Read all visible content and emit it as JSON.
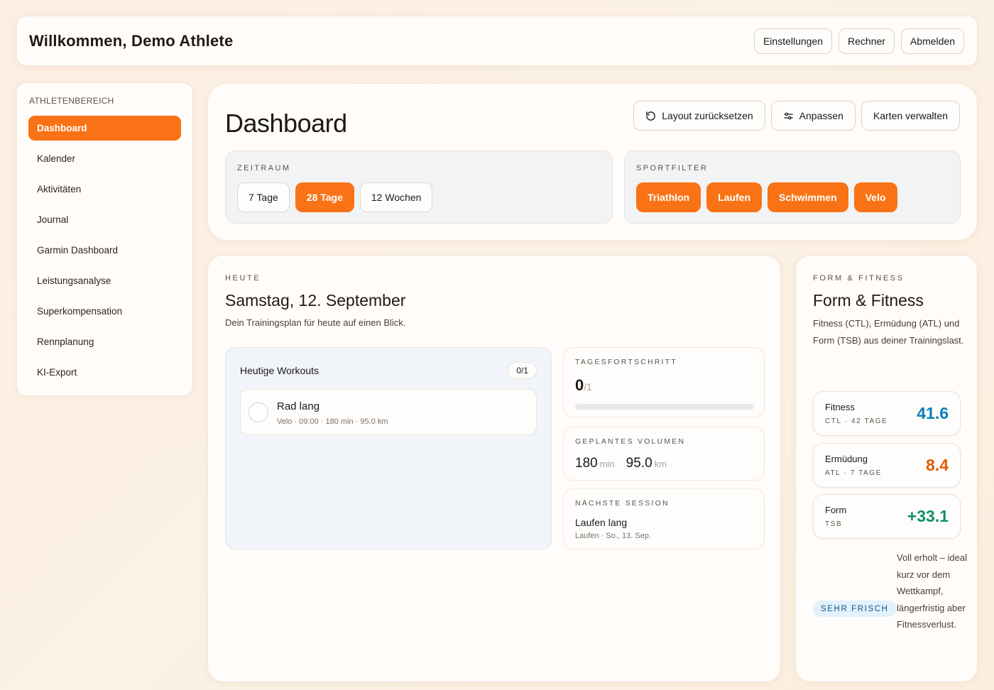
{
  "header": {
    "welcome": "Willkommen, Demo Athlete",
    "buttons": {
      "settings": "Einstellungen",
      "calculator": "Rechner",
      "logout": "Abmelden"
    }
  },
  "sidebar": {
    "caption": "ATHLETENBEREICH",
    "items": [
      {
        "label": "Dashboard",
        "active": true
      },
      {
        "label": "Kalender"
      },
      {
        "label": "Aktivitäten"
      },
      {
        "label": "Journal"
      },
      {
        "label": "Garmin Dashboard"
      },
      {
        "label": "Leistungsanalyse"
      },
      {
        "label": "Superkompensation"
      },
      {
        "label": "Rennplanung"
      },
      {
        "label": "KI-Export"
      }
    ]
  },
  "dashboard": {
    "title": "Dashboard",
    "actions": {
      "reset": "Layout zurücksetzen",
      "customize": "Anpassen",
      "manage": "Karten verwalten"
    },
    "timeframe": {
      "caption": "ZEITRAUM",
      "options": [
        {
          "label": "7 Tage"
        },
        {
          "label": "28 Tage",
          "selected": true
        },
        {
          "label": "12 Wochen"
        }
      ]
    },
    "sportfilter": {
      "caption": "SPORTFILTER",
      "options": [
        {
          "label": "Triathlon"
        },
        {
          "label": "Laufen"
        },
        {
          "label": "Schwimmen"
        },
        {
          "label": "Velo"
        }
      ]
    }
  },
  "today": {
    "eyebrow": "HEUTE",
    "date": "Samstag, 12. September",
    "subtitle": "Dein Trainingsplan für heute auf einen Blick.",
    "workouts": {
      "title": "Heutige Workouts",
      "count": "0/1",
      "items": [
        {
          "name": "Rad lang",
          "meta": "Velo · 09:00 · 180 min · 95.0 km",
          "done": false
        }
      ]
    },
    "progress": {
      "caption": "TAGESFORTSCHRITT",
      "done": "0",
      "total": "/1",
      "fraction": 0
    },
    "volume": {
      "caption": "GEPLANTES VOLUMEN",
      "minutes": "180",
      "minutes_unit": "min",
      "distance": "95.0",
      "distance_unit": "km"
    },
    "next": {
      "caption": "NÄCHSTE SESSION",
      "name": "Laufen lang",
      "meta": "Laufen · So., 13. Sep."
    }
  },
  "form": {
    "eyebrow": "FORM & FITNESS",
    "title": "Form & Fitness",
    "description": "Fitness (CTL), Ermüdung (ATL) und Form (TSB) aus deiner Trainingslast.",
    "metrics": [
      {
        "label": "Fitness",
        "sub": "CTL · 42 TAGE",
        "value": "41.6",
        "color": "#0a7fb8"
      },
      {
        "label": "Ermüdung",
        "sub": "ATL · 7 TAGE",
        "value": "8.4",
        "color": "#e05a0c"
      },
      {
        "label": "Form",
        "sub": "TSB",
        "value": "+33.1",
        "color": "#11906a"
      }
    ],
    "status_badge": "SEHR FRISCH",
    "status_text": "Voll erholt – ideal kurz vor dem Wettkampf, längerfristig aber Fitnessverlust."
  },
  "colors": {
    "accent": "#f97316",
    "fitness": "#0a7fb8",
    "fatigue": "#e05a0c",
    "form": "#11906a"
  },
  "icons": {
    "reset": "rotate-ccw-icon",
    "customize": "sliders-icon"
  }
}
